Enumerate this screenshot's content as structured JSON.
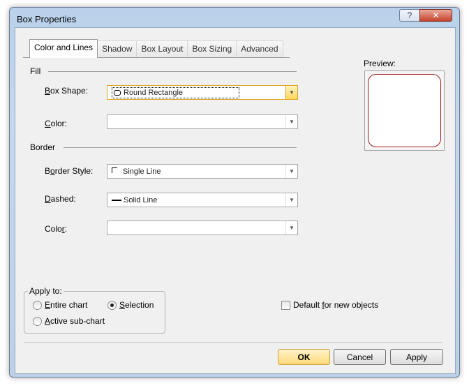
{
  "window": {
    "title": "Box Properties",
    "help_glyph": "?",
    "close_glyph": "✕"
  },
  "tabs": [
    {
      "label": "Color and Lines",
      "active": true
    },
    {
      "label": "Shadow"
    },
    {
      "label": "Box Layout"
    },
    {
      "label": "Box Sizing"
    },
    {
      "label": "Advanced"
    }
  ],
  "fill": {
    "section_label": "Fill",
    "box_shape": {
      "label_acc": "B",
      "label_rest": "ox Shape:",
      "value": "Round Rectangle"
    },
    "color": {
      "label_acc": "C",
      "label_rest": "olor:",
      "value": ""
    }
  },
  "border": {
    "section_label": "Border",
    "style": {
      "label_pre": "B",
      "label_acc": "o",
      "label_rest": "rder Style:",
      "value": "Single Line"
    },
    "dashed": {
      "label_acc": "D",
      "label_rest": "ashed:",
      "value": "Solid Line"
    },
    "color": {
      "label_pre": "Colo",
      "label_acc": "r",
      "label_rest": ":",
      "value_color": "#800000"
    }
  },
  "preview": {
    "label": "Preview:",
    "border_color": "#9b1c1c"
  },
  "apply_to": {
    "legend": "Apply to:",
    "entire_chart": {
      "label_pre": "",
      "label_acc": "E",
      "label_rest": "ntire chart",
      "selected": false
    },
    "selection": {
      "label_pre": "",
      "label_acc": "S",
      "label_rest": "election",
      "selected": true
    },
    "active_subchart": {
      "label_pre": "",
      "label_acc": "A",
      "label_rest": "ctive sub-chart",
      "selected": false
    }
  },
  "default_checkbox": {
    "label_pre": "Default ",
    "label_acc": "f",
    "label_rest": "or new objects",
    "checked": false
  },
  "buttons": {
    "ok": "OK",
    "cancel": "Cancel",
    "apply": "Apply"
  }
}
